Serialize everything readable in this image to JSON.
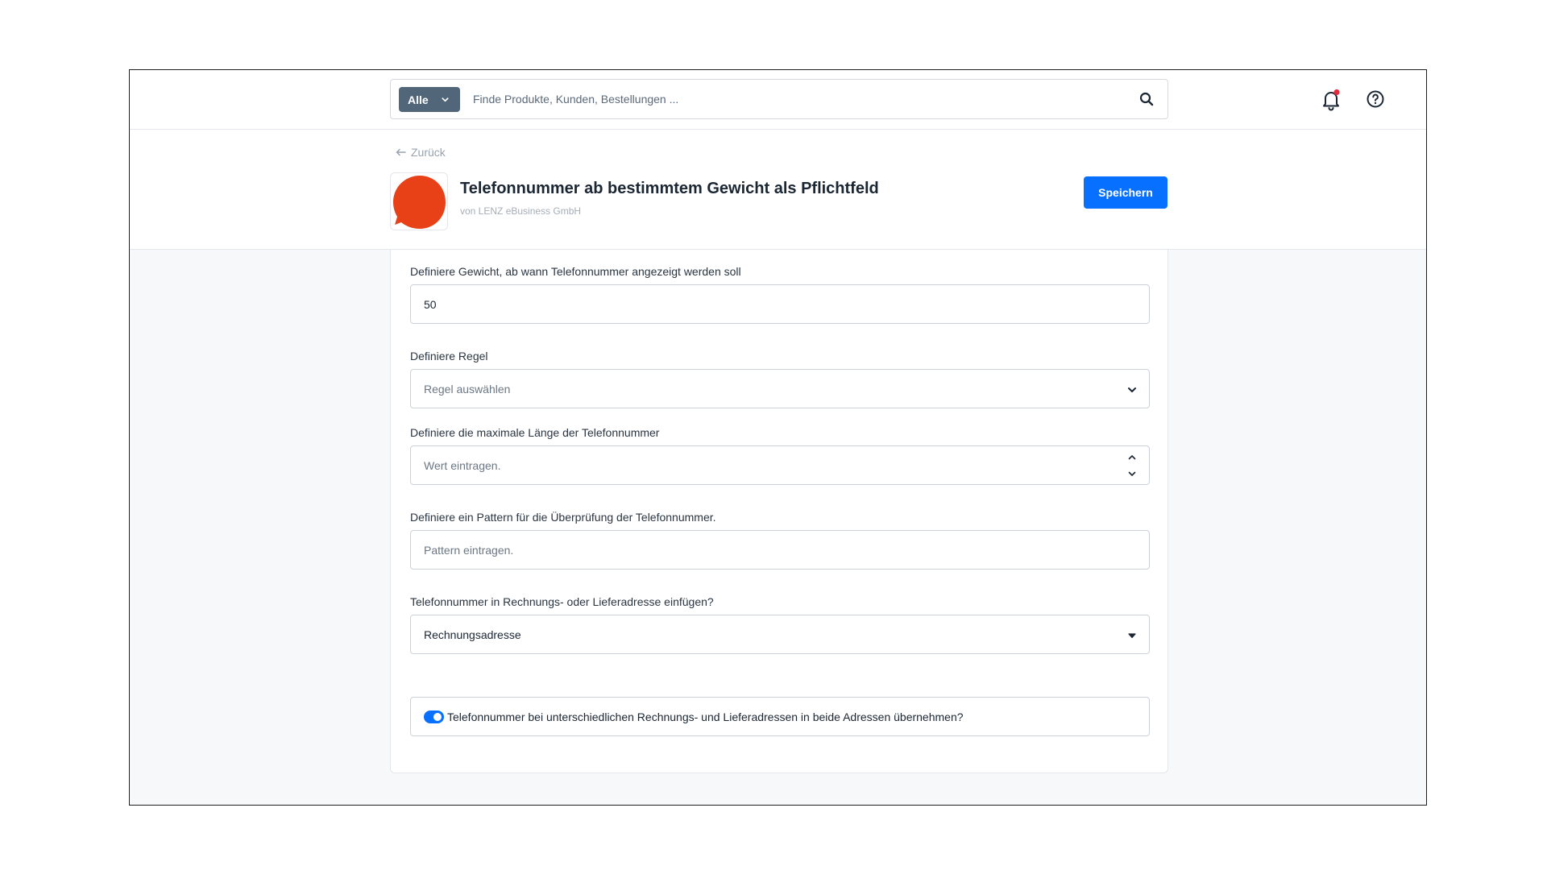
{
  "search": {
    "filter_label": "Alle",
    "placeholder": "Finde Produkte, Kunden, Bestellungen ..."
  },
  "header": {
    "back_label": "Zurück",
    "title": "Telefonnummer ab bestimmtem Gewicht als Pflichtfeld",
    "subtitle": "von LENZ eBusiness GmbH",
    "save_label": "Speichern",
    "notification_indicator": true
  },
  "form": {
    "weight": {
      "label": "Definiere Gewicht, ab wann Telefonnummer angezeigt werden soll",
      "value": "50"
    },
    "rule": {
      "label": "Definiere Regel",
      "placeholder": "Regel auswählen"
    },
    "max_length": {
      "label": "Definiere die maximale Länge der Telefonnummer",
      "placeholder": "Wert eintragen."
    },
    "pattern": {
      "label": "Definiere ein Pattern für die Überprüfung der Telefonnummer.",
      "placeholder": "Pattern eintragen."
    },
    "address": {
      "label": "Telefonnummer in Rechnungs- oder Lieferadresse einfügen?",
      "value": "Rechnungsadresse"
    },
    "copy_toggle": {
      "label": "Telefonnummer bei unterschiedlichen Rechnungs- und Lieferadressen in beide Adressen übernehmen?",
      "enabled": true
    }
  },
  "colors": {
    "primary": "#0870ff",
    "filter_bg": "#52667a",
    "logo": "#e84118",
    "notification_dot": "#e8283c"
  }
}
